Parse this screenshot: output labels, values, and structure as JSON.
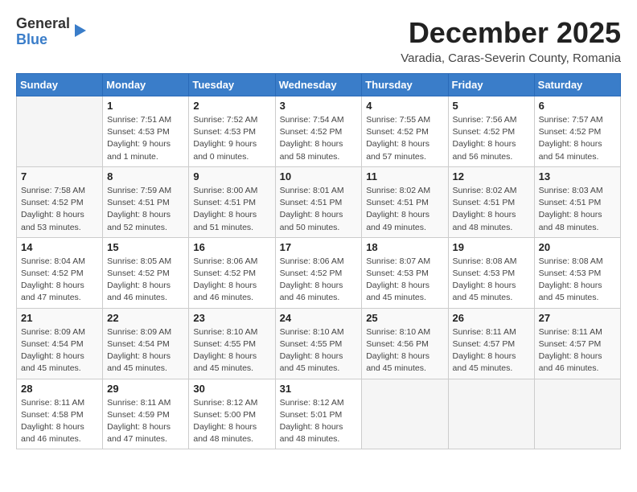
{
  "logo": {
    "general": "General",
    "blue": "Blue"
  },
  "header": {
    "month": "December 2025",
    "location": "Varadia, Caras-Severin County, Romania"
  },
  "days_of_week": [
    "Sunday",
    "Monday",
    "Tuesday",
    "Wednesday",
    "Thursday",
    "Friday",
    "Saturday"
  ],
  "weeks": [
    [
      {
        "day": "",
        "info": ""
      },
      {
        "day": "1",
        "info": "Sunrise: 7:51 AM\nSunset: 4:53 PM\nDaylight: 9 hours\nand 1 minute."
      },
      {
        "day": "2",
        "info": "Sunrise: 7:52 AM\nSunset: 4:53 PM\nDaylight: 9 hours\nand 0 minutes."
      },
      {
        "day": "3",
        "info": "Sunrise: 7:54 AM\nSunset: 4:52 PM\nDaylight: 8 hours\nand 58 minutes."
      },
      {
        "day": "4",
        "info": "Sunrise: 7:55 AM\nSunset: 4:52 PM\nDaylight: 8 hours\nand 57 minutes."
      },
      {
        "day": "5",
        "info": "Sunrise: 7:56 AM\nSunset: 4:52 PM\nDaylight: 8 hours\nand 56 minutes."
      },
      {
        "day": "6",
        "info": "Sunrise: 7:57 AM\nSunset: 4:52 PM\nDaylight: 8 hours\nand 54 minutes."
      }
    ],
    [
      {
        "day": "7",
        "info": "Sunrise: 7:58 AM\nSunset: 4:52 PM\nDaylight: 8 hours\nand 53 minutes."
      },
      {
        "day": "8",
        "info": "Sunrise: 7:59 AM\nSunset: 4:51 PM\nDaylight: 8 hours\nand 52 minutes."
      },
      {
        "day": "9",
        "info": "Sunrise: 8:00 AM\nSunset: 4:51 PM\nDaylight: 8 hours\nand 51 minutes."
      },
      {
        "day": "10",
        "info": "Sunrise: 8:01 AM\nSunset: 4:51 PM\nDaylight: 8 hours\nand 50 minutes."
      },
      {
        "day": "11",
        "info": "Sunrise: 8:02 AM\nSunset: 4:51 PM\nDaylight: 8 hours\nand 49 minutes."
      },
      {
        "day": "12",
        "info": "Sunrise: 8:02 AM\nSunset: 4:51 PM\nDaylight: 8 hours\nand 48 minutes."
      },
      {
        "day": "13",
        "info": "Sunrise: 8:03 AM\nSunset: 4:51 PM\nDaylight: 8 hours\nand 48 minutes."
      }
    ],
    [
      {
        "day": "14",
        "info": "Sunrise: 8:04 AM\nSunset: 4:52 PM\nDaylight: 8 hours\nand 47 minutes."
      },
      {
        "day": "15",
        "info": "Sunrise: 8:05 AM\nSunset: 4:52 PM\nDaylight: 8 hours\nand 46 minutes."
      },
      {
        "day": "16",
        "info": "Sunrise: 8:06 AM\nSunset: 4:52 PM\nDaylight: 8 hours\nand 46 minutes."
      },
      {
        "day": "17",
        "info": "Sunrise: 8:06 AM\nSunset: 4:52 PM\nDaylight: 8 hours\nand 46 minutes."
      },
      {
        "day": "18",
        "info": "Sunrise: 8:07 AM\nSunset: 4:53 PM\nDaylight: 8 hours\nand 45 minutes."
      },
      {
        "day": "19",
        "info": "Sunrise: 8:08 AM\nSunset: 4:53 PM\nDaylight: 8 hours\nand 45 minutes."
      },
      {
        "day": "20",
        "info": "Sunrise: 8:08 AM\nSunset: 4:53 PM\nDaylight: 8 hours\nand 45 minutes."
      }
    ],
    [
      {
        "day": "21",
        "info": "Sunrise: 8:09 AM\nSunset: 4:54 PM\nDaylight: 8 hours\nand 45 minutes."
      },
      {
        "day": "22",
        "info": "Sunrise: 8:09 AM\nSunset: 4:54 PM\nDaylight: 8 hours\nand 45 minutes."
      },
      {
        "day": "23",
        "info": "Sunrise: 8:10 AM\nSunset: 4:55 PM\nDaylight: 8 hours\nand 45 minutes."
      },
      {
        "day": "24",
        "info": "Sunrise: 8:10 AM\nSunset: 4:55 PM\nDaylight: 8 hours\nand 45 minutes."
      },
      {
        "day": "25",
        "info": "Sunrise: 8:10 AM\nSunset: 4:56 PM\nDaylight: 8 hours\nand 45 minutes."
      },
      {
        "day": "26",
        "info": "Sunrise: 8:11 AM\nSunset: 4:57 PM\nDaylight: 8 hours\nand 45 minutes."
      },
      {
        "day": "27",
        "info": "Sunrise: 8:11 AM\nSunset: 4:57 PM\nDaylight: 8 hours\nand 46 minutes."
      }
    ],
    [
      {
        "day": "28",
        "info": "Sunrise: 8:11 AM\nSunset: 4:58 PM\nDaylight: 8 hours\nand 46 minutes."
      },
      {
        "day": "29",
        "info": "Sunrise: 8:11 AM\nSunset: 4:59 PM\nDaylight: 8 hours\nand 47 minutes."
      },
      {
        "day": "30",
        "info": "Sunrise: 8:12 AM\nSunset: 5:00 PM\nDaylight: 8 hours\nand 48 minutes."
      },
      {
        "day": "31",
        "info": "Sunrise: 8:12 AM\nSunset: 5:01 PM\nDaylight: 8 hours\nand 48 minutes."
      },
      {
        "day": "",
        "info": ""
      },
      {
        "day": "",
        "info": ""
      },
      {
        "day": "",
        "info": ""
      }
    ]
  ]
}
